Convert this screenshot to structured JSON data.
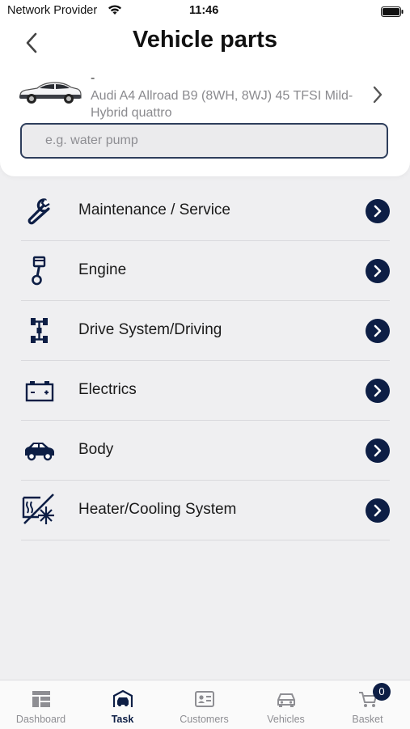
{
  "status_bar": {
    "carrier": "Network Provider",
    "time": "11:46"
  },
  "header": {
    "title": "Vehicle parts"
  },
  "vehicle": {
    "dash": "-",
    "name": "Audi A4 Allroad B9 (8WH, 8WJ) 45 TFSI Mild-Hybrid quattro"
  },
  "search": {
    "placeholder": "e.g. water pump",
    "value": ""
  },
  "categories": [
    {
      "label": "Maintenance / Service",
      "icon": "wrench-icon"
    },
    {
      "label": "Engine",
      "icon": "piston-icon"
    },
    {
      "label": "Drive System/Driving",
      "icon": "drivetrain-icon"
    },
    {
      "label": "Electrics",
      "icon": "battery-icon"
    },
    {
      "label": "Body",
      "icon": "car-body-icon"
    },
    {
      "label": "Heater/Cooling System",
      "icon": "heater-cooling-icon"
    }
  ],
  "tabbar": {
    "items": [
      {
        "label": "Dashboard",
        "icon": "dashboard-icon"
      },
      {
        "label": "Task",
        "icon": "task-icon",
        "active": true
      },
      {
        "label": "Customers",
        "icon": "customers-icon"
      },
      {
        "label": "Vehicles",
        "icon": "vehicles-icon"
      },
      {
        "label": "Basket",
        "icon": "basket-icon"
      }
    ],
    "basket_count": "0"
  },
  "colors": {
    "accent": "#0d1e45",
    "background": "#efeff1",
    "muted": "#8e8e93"
  }
}
